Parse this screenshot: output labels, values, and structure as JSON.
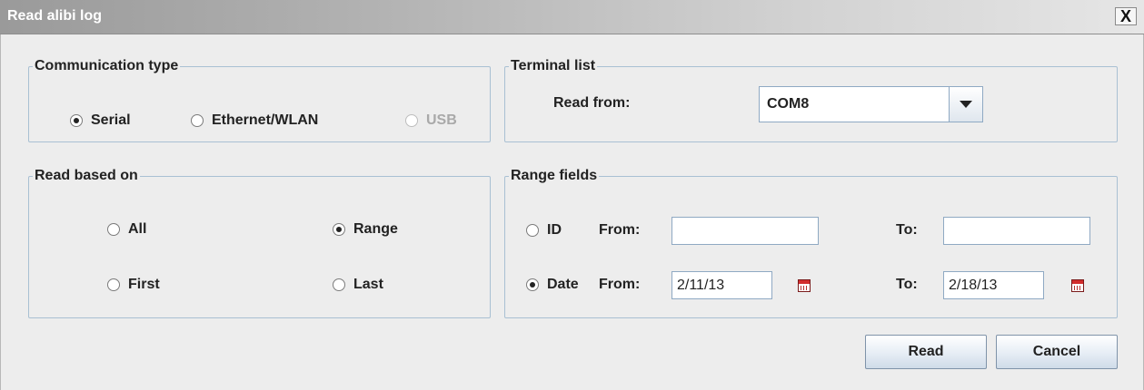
{
  "window": {
    "title": "Read alibi log",
    "close_label": "X"
  },
  "communication_type": {
    "legend": "Communication type",
    "options": [
      {
        "label": "Serial",
        "checked": true,
        "enabled": true
      },
      {
        "label": "Ethernet/WLAN",
        "checked": false,
        "enabled": true
      },
      {
        "label": "USB",
        "checked": false,
        "enabled": false
      }
    ]
  },
  "terminal_list": {
    "legend": "Terminal list",
    "read_from_label": "Read from:",
    "selected_port": "COM8"
  },
  "read_based_on": {
    "legend": "Read based on",
    "options": [
      {
        "label": "All",
        "checked": false
      },
      {
        "label": "Range",
        "checked": true
      },
      {
        "label": "First",
        "checked": false
      },
      {
        "label": "Last",
        "checked": false
      }
    ]
  },
  "range_fields": {
    "legend": "Range fields",
    "id_row": {
      "label": "ID",
      "checked": false,
      "from_label": "From:",
      "from_value": "",
      "to_label": "To:",
      "to_value": ""
    },
    "date_row": {
      "label": "Date",
      "checked": true,
      "from_label": "From:",
      "from_value": "2/11/13",
      "to_label": "To:",
      "to_value": "2/18/13"
    }
  },
  "buttons": {
    "read": "Read",
    "cancel": "Cancel"
  },
  "colors": {
    "group_border": "#a9c0d3",
    "title_text": "#ffffff",
    "calendar_red": "#d22c2c"
  }
}
